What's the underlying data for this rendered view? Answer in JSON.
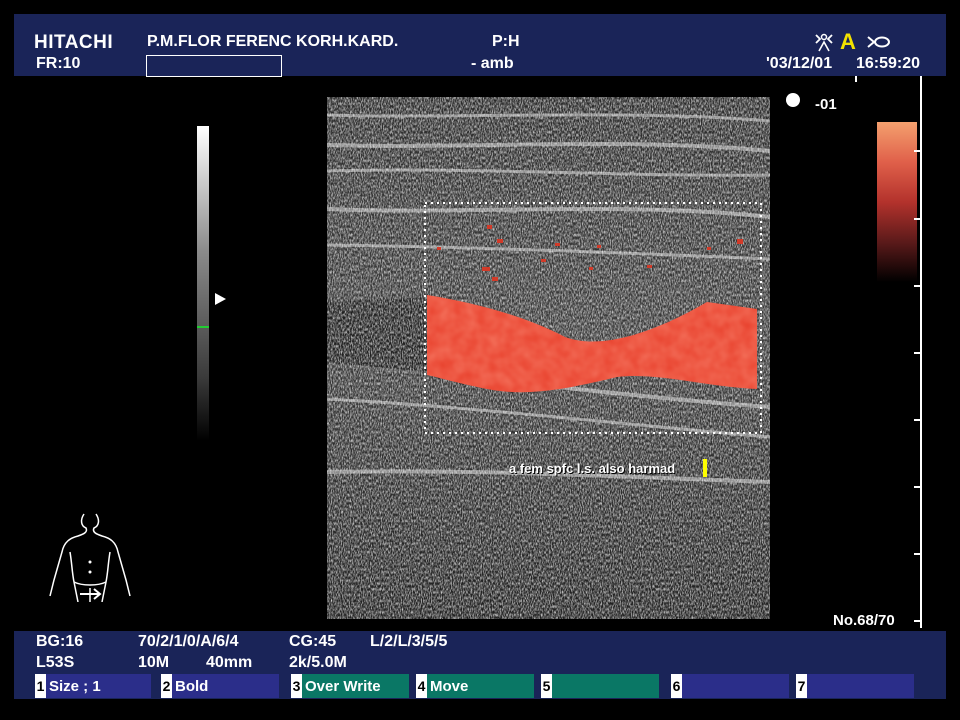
{
  "header": {
    "brand": "HITACHI",
    "frame_rate": "FR:10",
    "patient": "P.M.FLOR FERENC KORH.KARD.",
    "probe_pos": "P:H",
    "dept": "- amb",
    "date": "'03/12/01",
    "time": "16:59:20",
    "mode_letter": "A"
  },
  "indicator": {
    "depth_label": "-01"
  },
  "image": {
    "annotation": "a fem spfc l.s. also harmad"
  },
  "frame_counter": "No.68/70",
  "footer": {
    "row1": {
      "bg": "BG:16",
      "params1": "70/2/1/0/A/6/4",
      "cg": "CG:45",
      "params2": "L/2/L/3/5/5"
    },
    "row2": {
      "probe": "L53S",
      "freq": "10M",
      "depth": "40mm",
      "prf": "2k/5.0M"
    },
    "fkeys": [
      {
        "num": "1",
        "label": "Size ; 1"
      },
      {
        "num": "2",
        "label": "Bold"
      },
      {
        "num": "3",
        "label": "Over Write"
      },
      {
        "num": "4",
        "label": "Move"
      },
      {
        "num": "5",
        "label": ""
      },
      {
        "num": "6",
        "label": ""
      },
      {
        "num": "7",
        "label": ""
      }
    ]
  },
  "colors": {
    "header_bg": "#1a2458",
    "fkey_blue": "#2b2e8a",
    "fkey_teal": "#0a7765",
    "flow_red": "#e8402c",
    "cursor_yellow": "#ffff00"
  },
  "icons": {
    "sonographer": "person-icon",
    "mode": "a-mode-icon",
    "flow": "flow-direction-icon",
    "body_mark": "body-mark-icon"
  }
}
